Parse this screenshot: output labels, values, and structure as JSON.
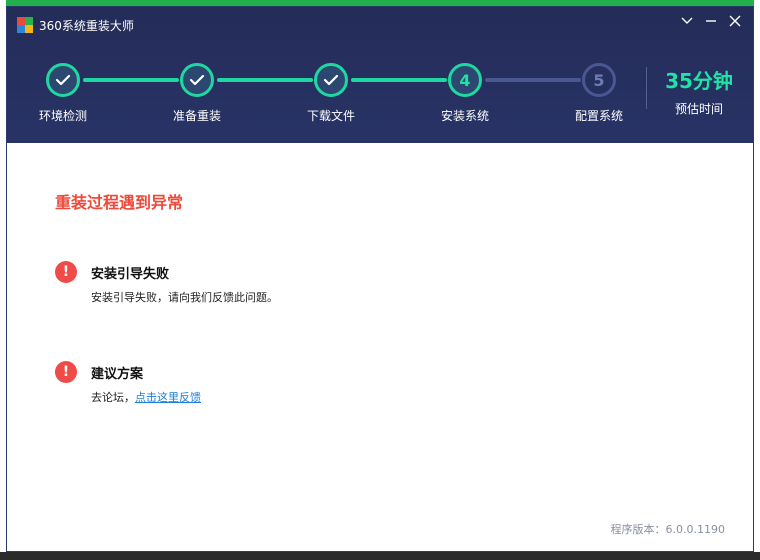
{
  "window": {
    "title": "360系统重装大师"
  },
  "steps": [
    {
      "index": "1",
      "label": "环境检测",
      "status": "done"
    },
    {
      "index": "2",
      "label": "准备重装",
      "status": "done"
    },
    {
      "index": "3",
      "label": "下载文件",
      "status": "done"
    },
    {
      "index": "4",
      "label": "安装系统",
      "status": "current"
    },
    {
      "index": "5",
      "label": "配置系统",
      "status": "pending"
    }
  ],
  "eta": {
    "value": "35分钟",
    "label": "预估时间"
  },
  "error": {
    "title": "重装过程遇到异常",
    "problem_heading": "安装引导失败",
    "problem_description": "安装引导失败，请向我们反馈此问题。",
    "suggestion_heading": "建议方案",
    "suggestion_prefix": "去论坛，",
    "suggestion_link": "点击这里反馈"
  },
  "version": "程序版本：6.0.0.1190",
  "colors": {
    "header_bg": "#262f5e",
    "accent_green": "#1fd7a0",
    "error_red": "#ee4a3c",
    "link_blue": "#1c7ed6"
  },
  "icons": {
    "check": "check-icon",
    "error": "exclamation-icon"
  }
}
